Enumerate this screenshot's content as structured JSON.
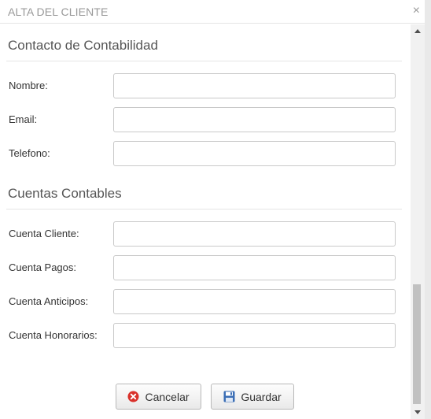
{
  "dialog": {
    "title": "ALTA DEL CLIENTE",
    "close_symbol": "×"
  },
  "contacto": {
    "heading": "Contacto de Contabilidad",
    "fields": [
      {
        "label": "Nombre:",
        "value": "",
        "placeholder": ""
      },
      {
        "label": "Email:",
        "value": "",
        "placeholder": ""
      },
      {
        "label": "Telefono:",
        "value": "",
        "placeholder": ""
      }
    ]
  },
  "cuentas": {
    "heading": "Cuentas Contables",
    "fields": [
      {
        "label": "Cuenta Cliente:",
        "value": "",
        "placeholder": ""
      },
      {
        "label": "Cuenta Pagos:",
        "value": "",
        "placeholder": ""
      },
      {
        "label": "Cuenta Anticipos:",
        "value": "",
        "placeholder": ""
      },
      {
        "label": "Cuenta Honorarios:",
        "value": "",
        "placeholder": ""
      }
    ]
  },
  "actions": {
    "cancel_label": "Cancelar",
    "cancel_icon": "cancel-x-icon",
    "save_label": "Guardar",
    "save_icon": "floppy-disk-icon"
  },
  "colors": {
    "cancel_icon": "#d9312b",
    "save_icon": "#3b6eb5"
  }
}
